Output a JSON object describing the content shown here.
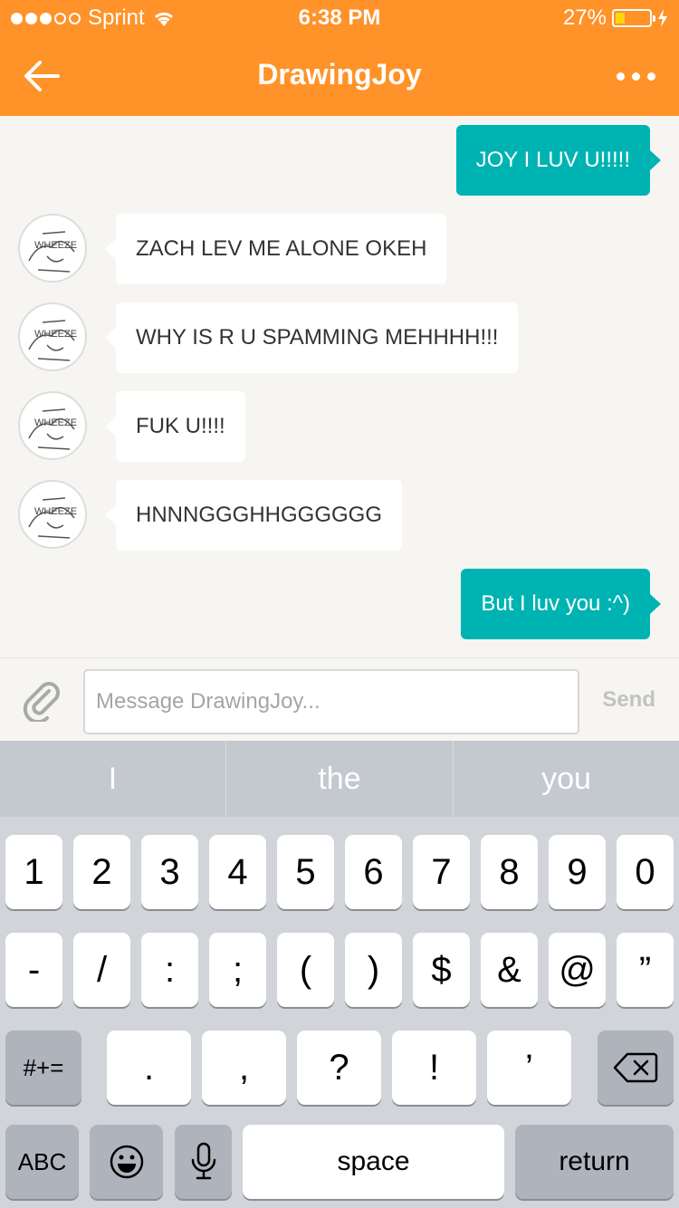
{
  "status_bar": {
    "carrier": "Sprint",
    "time": "6:38 PM",
    "battery": "27%",
    "battery_level": 0.27
  },
  "header": {
    "title": "DrawingJoy"
  },
  "messages": [
    {
      "direction": "out",
      "text": "JOY I LUV U!!!!!"
    },
    {
      "direction": "in",
      "text": "ZACH LEV ME ALONE OKEH"
    },
    {
      "direction": "in",
      "text": "WHY IS R U SPAMMING MEHHHH!!!"
    },
    {
      "direction": "in",
      "text": "FUK U!!!!"
    },
    {
      "direction": "in",
      "text": "HNNNGGGHHGGGGGG"
    },
    {
      "direction": "out",
      "text": "But I luv you :^)"
    }
  ],
  "composer": {
    "placeholder": "Message DrawingJoy...",
    "send_label": "Send"
  },
  "keyboard": {
    "suggestions": [
      "I",
      "the",
      "you"
    ],
    "row1": [
      "1",
      "2",
      "3",
      "4",
      "5",
      "6",
      "7",
      "8",
      "9",
      "0"
    ],
    "row2": [
      "-",
      "/",
      ":",
      ";",
      "(",
      ")",
      "$",
      "&",
      "@",
      "”"
    ],
    "row3_left": "#+=",
    "row3_keys": [
      ".",
      ",",
      "?",
      "!",
      "’"
    ],
    "abc": "ABC",
    "space": "space",
    "return": "return"
  },
  "icons": {
    "back": "arrow-left-icon",
    "more": "ellipsis-icon",
    "attach": "paperclip-icon",
    "avatar": "avatar-image",
    "backspace": "backspace-icon",
    "emoji": "emoji-icon",
    "mic": "microphone-icon"
  },
  "colors": {
    "header": "#ff9228",
    "outgoing_bubble": "#00b3b3"
  }
}
